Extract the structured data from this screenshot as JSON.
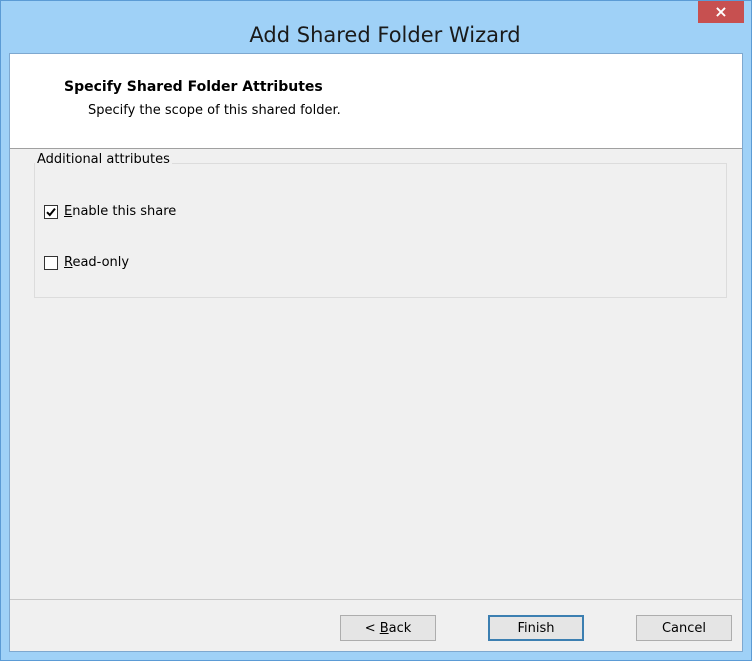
{
  "window": {
    "title": "Add Shared Folder Wizard",
    "close_label": "×"
  },
  "header": {
    "title": "Specify Shared Folder Attributes",
    "subtitle": "Specify the scope of this shared folder."
  },
  "attributes": {
    "group_label": "Additional attributes",
    "enable_share": {
      "accel": "E",
      "rest": "nable this share",
      "checked": true
    },
    "read_only": {
      "accel": "R",
      "rest": "ead-only",
      "checked": false
    }
  },
  "buttons": {
    "back_prefix": "< ",
    "back_accel": "B",
    "back_rest": "ack",
    "finish": "Finish",
    "cancel": "Cancel"
  },
  "colors": {
    "titlebar": "#9fd1f7",
    "close": "#c75050",
    "dialog_bg": "#f0f0f0",
    "default_button_border": "#3c7fb1"
  }
}
